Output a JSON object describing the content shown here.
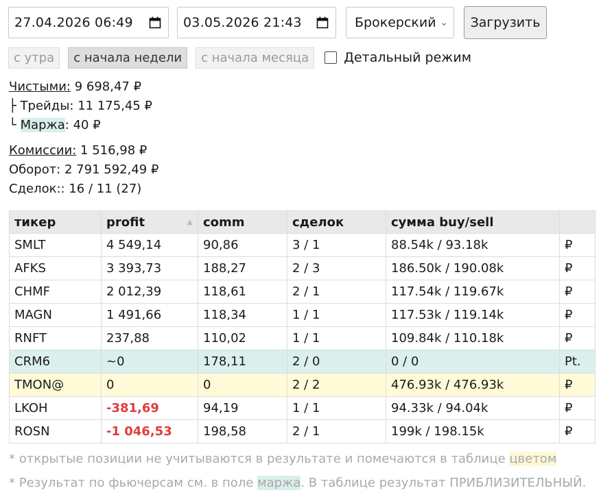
{
  "filters": {
    "date_from": "27.04.2026  06:49",
    "date_to": "03.05.2026  21:43",
    "account_select": "Брокерский",
    "load_button": "Загрузить"
  },
  "presets": {
    "morning": "с утра",
    "week": "с начала недели",
    "month": "с начала месяца",
    "detail_mode": "Детальный режим"
  },
  "summary": {
    "net_label": "Чистыми:",
    "net_value": " 9 698,47 ₽",
    "trades_prefix": "├ Трейды:",
    "trades_value": " 11 175,45 ₽",
    "margin_prefix": "└ ",
    "margin_label": "Маржа",
    "margin_value": ": 40 ₽",
    "fees_label": "Комиссии:",
    "fees_value": " 1 516,98 ₽",
    "turnover": "Оборот: 2 791 592,49 ₽",
    "deals": "Сделок:: 16 / 11 (27)"
  },
  "table": {
    "headers": [
      "тикер",
      "profit",
      "comm",
      "сделок",
      "сумма buy/sell",
      ""
    ],
    "sort_indicator": "▲",
    "rows": [
      {
        "ticker": "SMLT",
        "profit": "4 549,14",
        "comm": "90,86",
        "deals": "3 / 1",
        "sum": "88.54k / 93.18k",
        "cur": "₽"
      },
      {
        "ticker": "AFKS",
        "profit": "3 393,73",
        "comm": "188,27",
        "deals": "2 / 3",
        "sum": "186.50k / 190.08k",
        "cur": "₽"
      },
      {
        "ticker": "CHMF",
        "profit": "2 012,39",
        "comm": "118,61",
        "deals": "2 / 1",
        "sum": "117.54k / 119.67k",
        "cur": "₽"
      },
      {
        "ticker": "MAGN",
        "profit": "1 491,66",
        "comm": "118,34",
        "deals": "1 / 1",
        "sum": "117.53k / 119.14k",
        "cur": "₽"
      },
      {
        "ticker": "RNFT",
        "profit": "237,88",
        "comm": "110,02",
        "deals": "1 / 1",
        "sum": "109.84k / 110.18k",
        "cur": "₽"
      },
      {
        "ticker": "CRM6",
        "profit": "~0",
        "comm": "178,11",
        "deals": "2 / 0",
        "sum": "0 / 0",
        "cur": "Pt."
      },
      {
        "ticker": "TMON@",
        "profit": "0",
        "comm": "0",
        "deals": "2 / 2",
        "sum": "476.93k / 476.93k",
        "cur": "₽"
      },
      {
        "ticker": "LKOH",
        "profit": "-381,69",
        "comm": "94,19",
        "deals": "1 / 1",
        "sum": "94.33k / 94.04k",
        "cur": "₽"
      },
      {
        "ticker": "ROSN",
        "profit": "-1 046,53",
        "comm": "198,58",
        "deals": "2 / 1",
        "sum": "199k / 198.15k",
        "cur": "₽"
      }
    ]
  },
  "notes": {
    "note1_text": "* открытые позиции не учитываются в результате и помечаются в таблице ",
    "note1_hl": "цветом",
    "note2_a": "* Результат по фьючерсам см. в поле ",
    "note2_hl": "маржа",
    "note2_b": ". В таблице результат ПРИБЛИЗИТЕЛЬНЫЙ."
  },
  "colors": {
    "negative": "#e03c3c",
    "futures_row": "#dbf0ec",
    "open_position_row": "#fffbd9"
  }
}
